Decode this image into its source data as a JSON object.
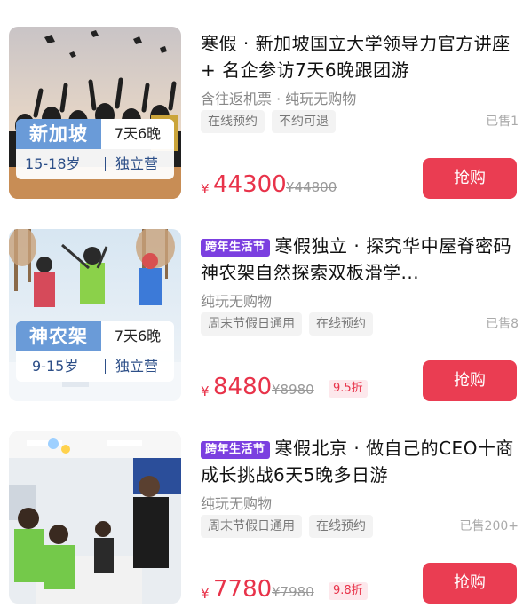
{
  "products": [
    {
      "destination": "新加坡",
      "duration": "7天6晚",
      "age_range": "15-18岁",
      "camp_type": "独立营",
      "festival_badge": "",
      "title": "寒假 · 新加坡国立大学领导力官方讲座 + 名企参访7天6晚跟团游",
      "subtitle": "含往返机票 · 纯玩无购物",
      "chips": [
        "在线预约",
        "不约可退"
      ],
      "sold": "已售1",
      "currency": "¥",
      "price": "44300",
      "original_price": "¥44800",
      "discount": "",
      "buy_label": "抢购"
    },
    {
      "destination": "神农架",
      "duration": "7天6晚",
      "age_range": "9-15岁",
      "camp_type": "独立营",
      "festival_badge": "跨年生活节",
      "title": "寒假独立 · 探究华中屋脊密码神农架自然探索双板滑学...",
      "subtitle": "纯玩无购物",
      "chips": [
        "周末节假日通用",
        "在线预约"
      ],
      "sold": "已售8",
      "currency": "¥",
      "price": "8480",
      "original_price": "¥8980",
      "discount": "9.5折",
      "buy_label": "抢购"
    },
    {
      "destination": "",
      "duration": "",
      "age_range": "",
      "camp_type": "",
      "festival_badge": "跨年生活节",
      "title": "寒假北京 · 做自己的CEO十商成长挑战6天5晚多日游",
      "subtitle": "纯玩无购物",
      "chips": [
        "周末节假日通用",
        "在线预约"
      ],
      "sold": "已售200+",
      "currency": "¥",
      "price": "7780",
      "original_price": "¥7980",
      "discount": "9.8折",
      "buy_label": "抢购"
    }
  ],
  "colors": {
    "accent_red": "#ea3d52",
    "price_red": "#e8334a",
    "festival_purple": "#7b3fe0",
    "tag_blue": "#6a9bd8"
  }
}
